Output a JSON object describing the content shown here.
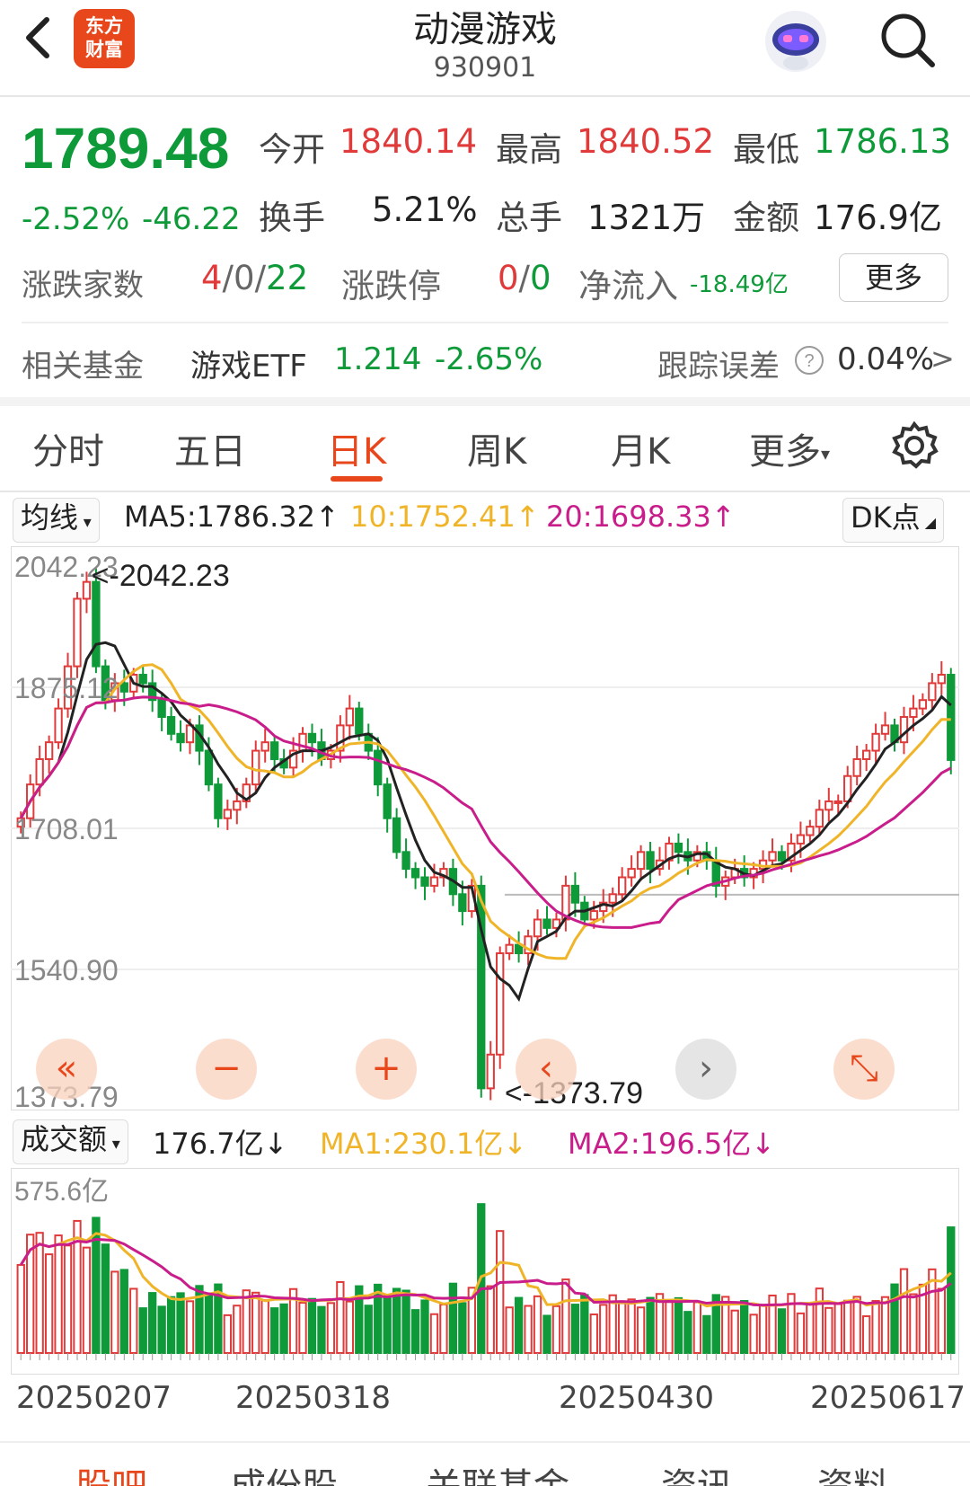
{
  "header": {
    "logo_line1": "东方",
    "logo_line2": "财富",
    "title": "动漫游戏",
    "code": "930901"
  },
  "quote": {
    "price": "1789.48",
    "change_pct": "-2.52%",
    "change": "-46.22",
    "open_label": "今开",
    "open": "1840.14",
    "high_label": "最高",
    "high": "1840.52",
    "low_label": "最低",
    "low": "1786.13",
    "turnover_label": "换手",
    "turnover": "5.21%",
    "volume_label": "总手",
    "volume": "1321万",
    "amount_label": "金额",
    "amount": "176.9亿",
    "updown_label": "涨跌家数",
    "up": "4",
    "flat": "0",
    "down": "22",
    "sep": "/",
    "limit_label": "涨跌停",
    "limit_up": "0",
    "limit_down": "0",
    "netflow_label": "净流入",
    "netflow": "-18.49亿",
    "more_label": "更多"
  },
  "fund": {
    "label": "相关基金",
    "name": "游戏ETF",
    "price": "1.214",
    "change": "-2.65%",
    "tracking_label": "跟踪误差",
    "tracking_value": "0.04%",
    "arrow": ">"
  },
  "tabs": [
    "分时",
    "五日",
    "日K",
    "周K",
    "月K",
    "更多"
  ],
  "active_tab": 2,
  "ma_bar": {
    "selector": "均线",
    "ma5": "MA5:1786.32↑",
    "ma10": "10:1752.41↑",
    "ma20": "20:1698.33↑",
    "dk": "DK点"
  },
  "price_axis": [
    "2042.23",
    "1875.12",
    "1708.01",
    "1540.90",
    "1373.79"
  ],
  "max_annot": "<-2042.23",
  "min_annot": "<-1373.79",
  "volume_bar": {
    "selector": "成交额",
    "value": "176.7亿↓",
    "ma1": "MA1:230.1亿↓",
    "ma2": "MA2:196.5亿↓"
  },
  "volume_axis_top": "575.6亿",
  "date_labels": [
    "20250207",
    "20250318",
    "20250430",
    "20250617"
  ],
  "bottom_tabs": [
    "股吧",
    "成份股",
    "关联基金",
    "资讯",
    "资料"
  ],
  "colors": {
    "up": "#e03a3a",
    "down": "#0f9a3a",
    "accent": "#e8471c",
    "ma5": "#222222",
    "ma10": "#f0b429",
    "ma20": "#c81d8a"
  },
  "chart_data": {
    "type": "candlestick",
    "ylim": [
      1373.79,
      2042.23
    ],
    "closes": [
      1720,
      1760,
      1790,
      1810,
      1850,
      1900,
      1980,
      2000,
      1900,
      1860,
      1880,
      1870,
      1890,
      1880,
      1860,
      1840,
      1820,
      1810,
      1830,
      1800,
      1760,
      1720,
      1730,
      1740,
      1760,
      1800,
      1810,
      1790,
      1780,
      1800,
      1820,
      1810,
      1790,
      1800,
      1830,
      1850,
      1820,
      1800,
      1760,
      1720,
      1680,
      1660,
      1650,
      1640,
      1650,
      1660,
      1630,
      1610,
      1640,
      1400,
      1440,
      1560,
      1570,
      1560,
      1580,
      1600,
      1590,
      1600,
      1640,
      1620,
      1600,
      1610,
      1620,
      1630,
      1650,
      1660,
      1680,
      1660,
      1670,
      1690,
      1680,
      1670,
      1680,
      1670,
      1640,
      1650,
      1660,
      1650,
      1660,
      1670,
      1680,
      1670,
      1690,
      1700,
      1710,
      1730,
      1740,
      1740,
      1770,
      1790,
      1800,
      1820,
      1830,
      1810,
      1840,
      1850,
      1860,
      1880,
      1890,
      1789
    ]
  }
}
